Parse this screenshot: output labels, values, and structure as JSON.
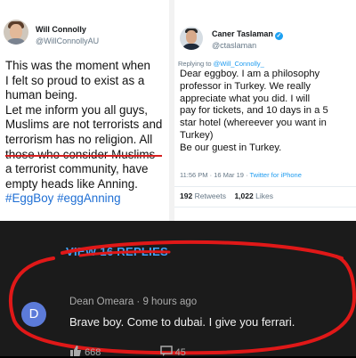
{
  "tweet_left": {
    "name": "Will Connolly",
    "handle": "@WillConnollyAU",
    "lines": [
      "This was the moment when",
      "I felt so proud to exist as a",
      "human being.",
      "Let me inform you all guys,",
      "Muslims are not terrorists and",
      "terrorism has no religion. All",
      "those who consider Muslims",
      "a terrorist community, have",
      "empty heads like Anning."
    ],
    "hashtags": "#EggBoy #eggAnning"
  },
  "tweet_right": {
    "name": "Caner Taslaman",
    "handle": "@ctaslaman",
    "reply_prefix": "Replying to ",
    "reply_handle": "@Will_Connolly_",
    "lines": [
      "Dear eggboy. I am a philosophy",
      "professor in Turkey. We really",
      "appreciate what you did. I will",
      "pay for tickets, and 10 days in a 5",
      "star hotel (whereever you want in",
      "Turkey)",
      "Be our guest in Turkey."
    ],
    "time": "11:56 PM · 16 Mar 19 · ",
    "source": "Twitter for iPhone",
    "retweets_count": "192",
    "retweets_label": "Retweets",
    "likes_count": "1,022",
    "likes_label": "Likes"
  },
  "comment": {
    "view_replies": "VIEW 16 REPLIES",
    "avatar_letter": "D",
    "author": "Dean Omeara · 9 hours ago",
    "text": "Brave boy. Come to dubai. I give you ferrari.",
    "likes": "668",
    "replies": "45"
  },
  "colors": {
    "link_blue": "#1d9bf0",
    "annotation_red": "#d61f1f",
    "youtube_link": "#3ea6ff",
    "avatar_blue": "#5c7bd9"
  }
}
